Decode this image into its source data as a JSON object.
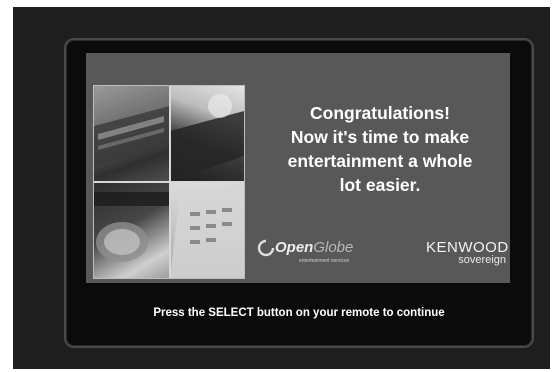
{
  "headline": {
    "line1": "Congratulations!",
    "line2": "Now it's time to make",
    "line3": "entertainment a whole",
    "line4": "lot easier."
  },
  "logos": {
    "openglobe": {
      "word_bold": "Open",
      "word_light": "Globe",
      "tagline": "entertainment services"
    },
    "kenwood": {
      "name": "KENWOOD",
      "sub": "sovereign"
    }
  },
  "footer": {
    "message": "Press the SELECT button on your remote to continue"
  },
  "colors": {
    "screen_bg": "#1e1e1e",
    "panel_bg": "#585858",
    "text": "#ffffff"
  }
}
